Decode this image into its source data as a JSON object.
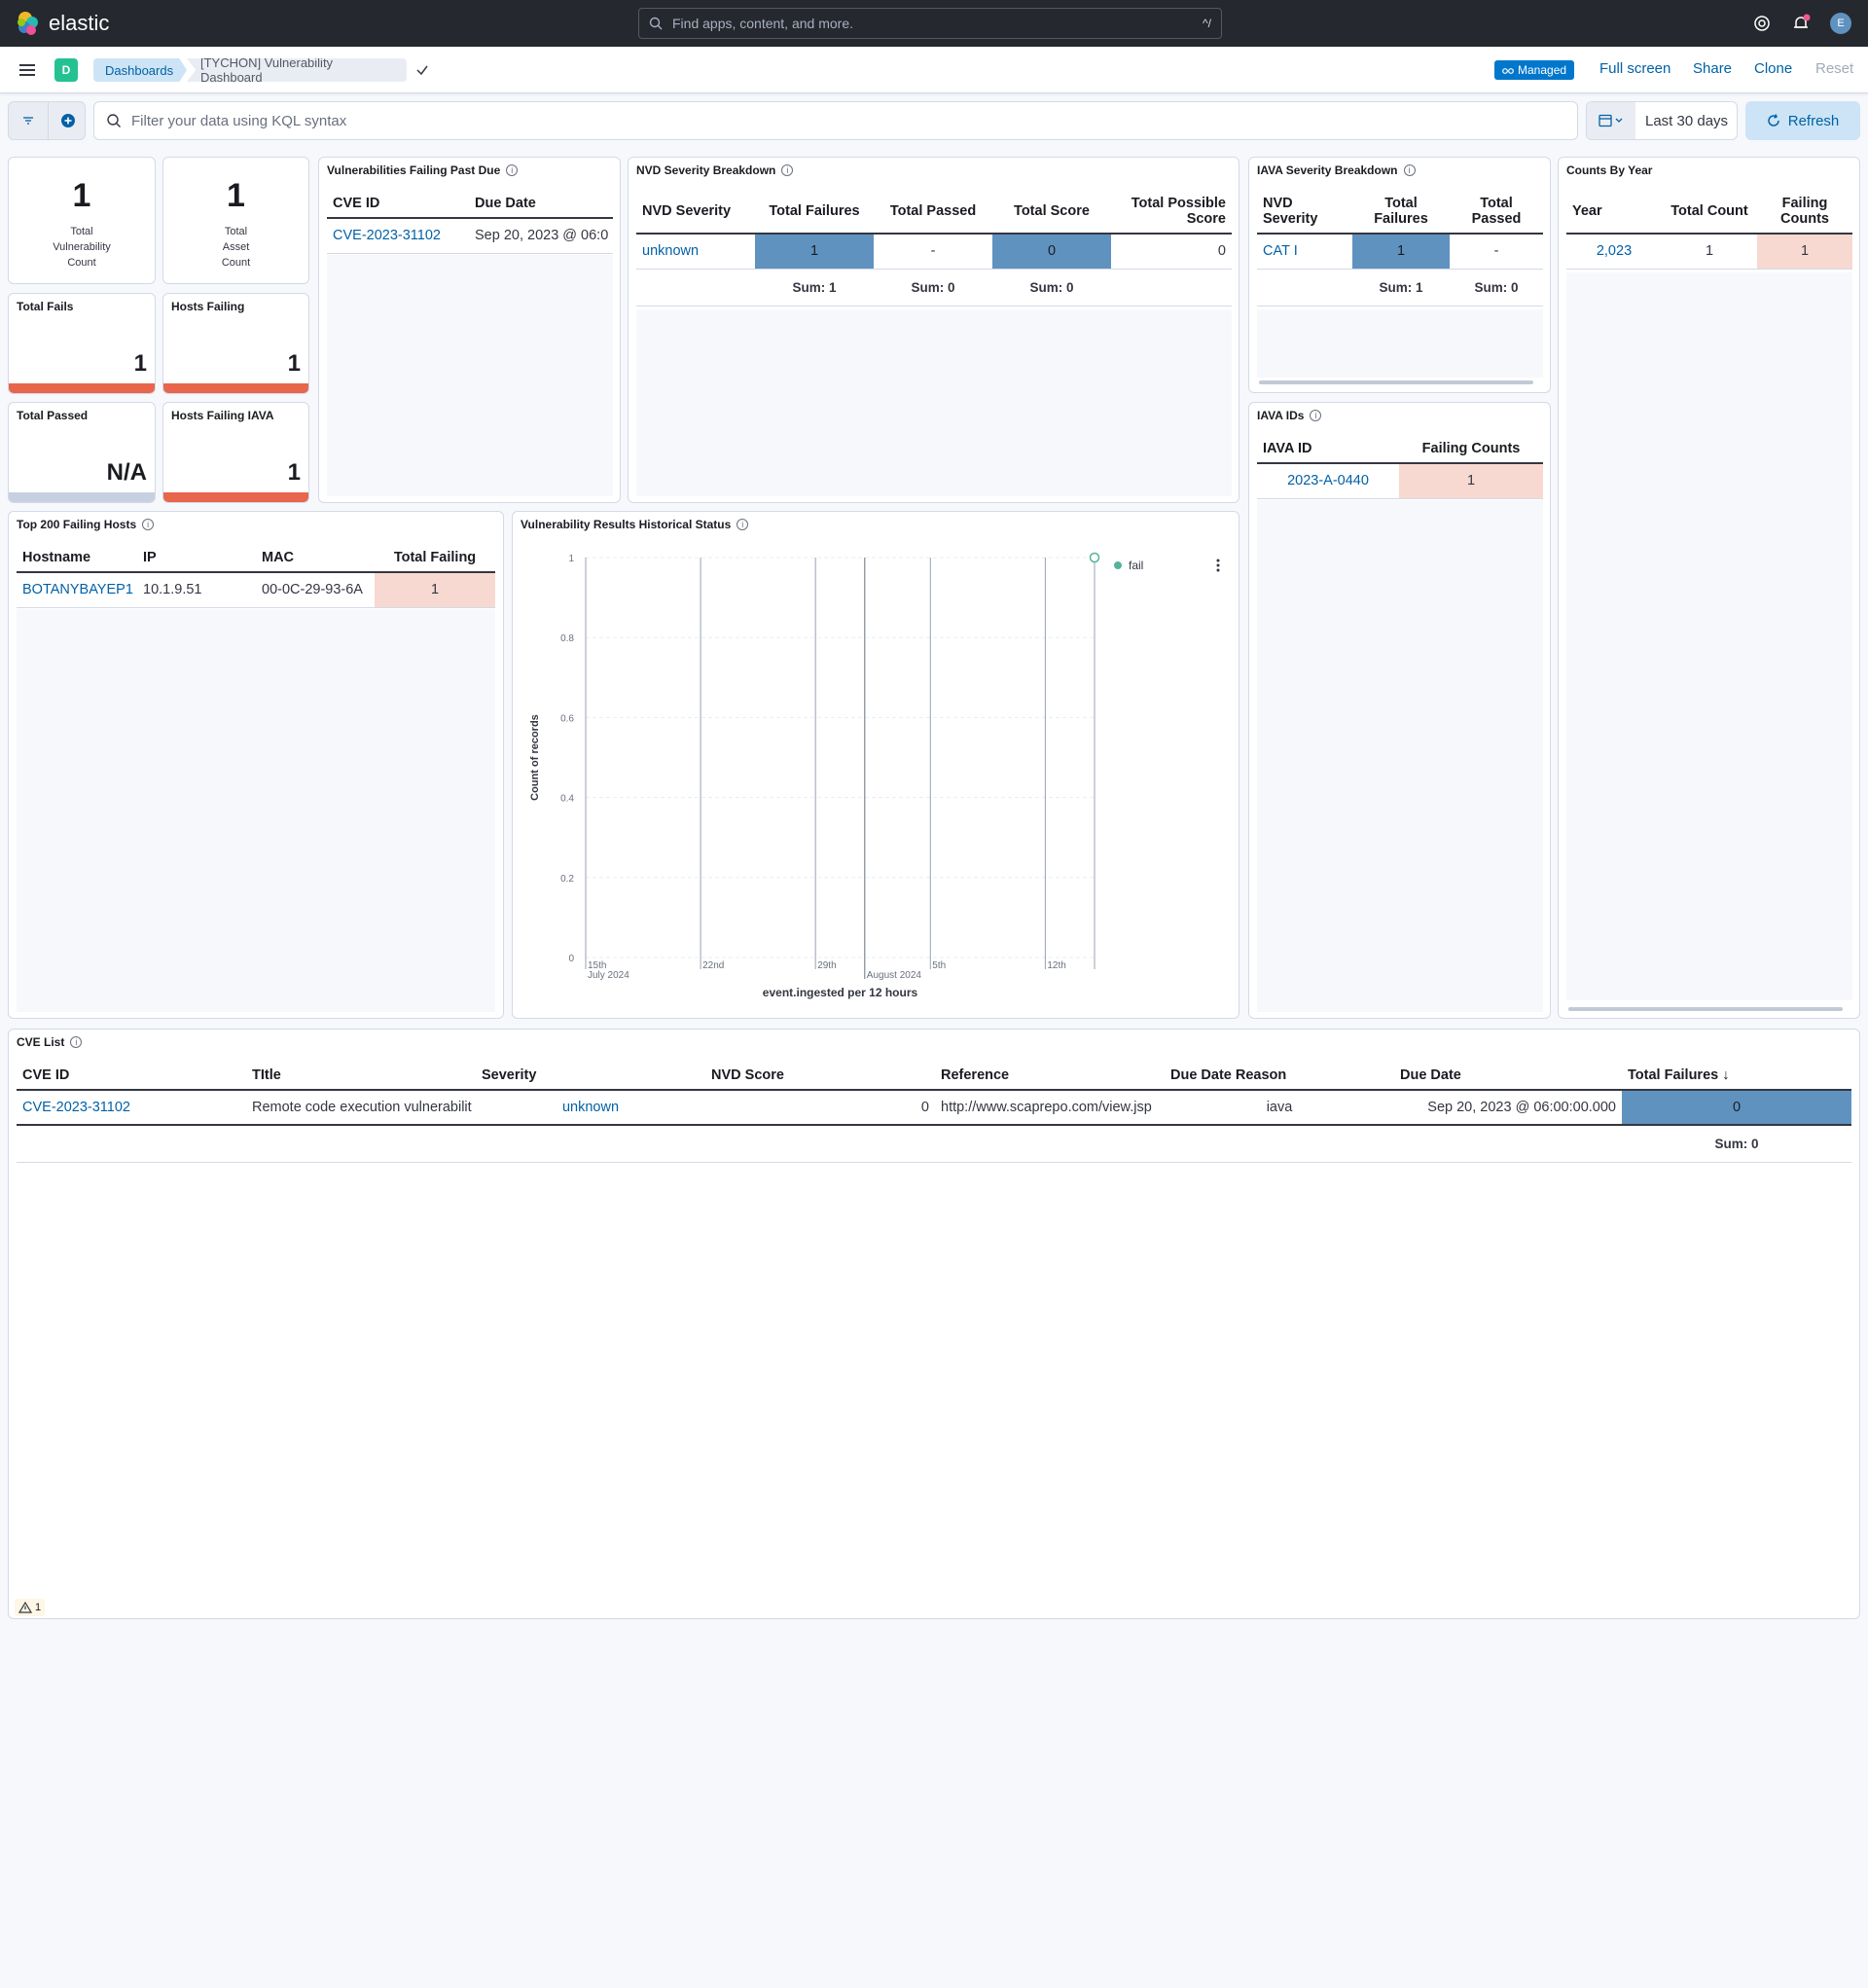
{
  "header": {
    "logo_text": "elastic",
    "search_placeholder": "Find apps, content, and more.",
    "search_shortcut": "^/",
    "avatar_letter": "E"
  },
  "breadcrumbs": {
    "space_letter": "D",
    "items": [
      "Dashboards",
      "[TYCHON] Vulnerability Dashboard"
    ]
  },
  "actions": {
    "managed": "Managed",
    "full_screen": "Full screen",
    "share": "Share",
    "clone": "Clone",
    "reset": "Reset"
  },
  "query": {
    "placeholder": "Filter your data using KQL syntax",
    "date_range": "Last 30 days",
    "refresh": "Refresh"
  },
  "metrics": {
    "total_vuln": {
      "value": "1",
      "label_lines": [
        "Total",
        "Vulnerability",
        "Count"
      ]
    },
    "total_asset": {
      "value": "1",
      "label_lines": [
        "Total",
        "Asset",
        "Count"
      ]
    },
    "total_fails": {
      "title": "Total Fails",
      "value": "1"
    },
    "hosts_failing": {
      "title": "Hosts Failing",
      "value": "1"
    },
    "total_passed": {
      "title": "Total Passed",
      "value": "N/A"
    },
    "hosts_failing_iava": {
      "title": "Hosts Failing IAVA",
      "value": "1"
    }
  },
  "past_due": {
    "title": "Vulnerabilities Failing Past Due",
    "columns": [
      "CVE ID",
      "Due Date"
    ],
    "rows": [
      [
        "CVE-2023-31102",
        "Sep 20, 2023 @ 06:0"
      ]
    ]
  },
  "nvd": {
    "title": "NVD Severity Breakdown",
    "columns": [
      "NVD Severity",
      "Total Failures",
      "Total Passed",
      "Total Score",
      "Total Possible Score"
    ],
    "rows": [
      [
        "unknown",
        "1",
        "-",
        "0",
        "0"
      ]
    ],
    "sums": [
      "Sum: 1",
      "Sum: 0",
      "Sum: 0"
    ]
  },
  "iava_sev": {
    "title": "IAVA Severity Breakdown",
    "columns": [
      "NVD Severity",
      "Total Failures",
      "Total Passed"
    ],
    "rows": [
      [
        "CAT I",
        "1",
        "-"
      ]
    ],
    "sums": [
      "Sum: 1",
      "Sum: 0"
    ]
  },
  "by_year": {
    "title": "Counts By Year",
    "columns": [
      "Year",
      "Total Count",
      "Failing Counts"
    ],
    "rows": [
      [
        "2,023",
        "1",
        "1"
      ]
    ]
  },
  "iava_ids": {
    "title": "IAVA IDs",
    "columns": [
      "IAVA ID",
      "Failing Counts"
    ],
    "rows": [
      [
        "2023-A-0440",
        "1"
      ]
    ]
  },
  "top_hosts": {
    "title": "Top 200 Failing Hosts",
    "columns": [
      "Hostname",
      "IP",
      "MAC",
      "Total Failing"
    ],
    "rows": [
      [
        "BOTANYBAYEP1",
        "10.1.9.51",
        "00-0C-29-93-6A",
        "1"
      ]
    ]
  },
  "history": {
    "title": "Vulnerability Results Historical Status"
  },
  "chart_data": {
    "type": "line",
    "title": "Vulnerability Results Historical Status",
    "xlabel": "event.ingested per 12 hours",
    "ylabel": "Count of records",
    "x_ticks": [
      "15th",
      "22nd",
      "29th",
      "5th",
      "12th"
    ],
    "x_period_labels": [
      "July 2024",
      "August 2024"
    ],
    "y_ticks": [
      "0",
      "0.2",
      "0.4",
      "0.6",
      "0.8",
      "1"
    ],
    "ylim": [
      0,
      1
    ],
    "series": [
      {
        "name": "fail",
        "color": "#54b399",
        "points": [
          {
            "x": "2024-08-15",
            "y": 1
          }
        ]
      }
    ],
    "legend": "top-right",
    "grid": true
  },
  "cve_list": {
    "title": "CVE List",
    "columns": [
      "CVE ID",
      "TItle",
      "Severity",
      "NVD Score",
      "Reference",
      "Due Date Reason",
      "Due Date",
      "Total Failures"
    ],
    "rows": [
      [
        "CVE-2023-31102",
        "Remote code execution vulnerabilit",
        "unknown",
        "0",
        "http://www.scaprepo.com/view.jsp",
        "iava",
        "Sep 20, 2023 @ 06:00:00.000",
        "0"
      ]
    ],
    "sum": "Sum: 0",
    "warning_count": "1"
  },
  "colors": {
    "accent": "#0077cc",
    "fail_bar": "#e7664c",
    "cell_blue": "#6092c0",
    "cell_pink": "#f8d9d2"
  }
}
